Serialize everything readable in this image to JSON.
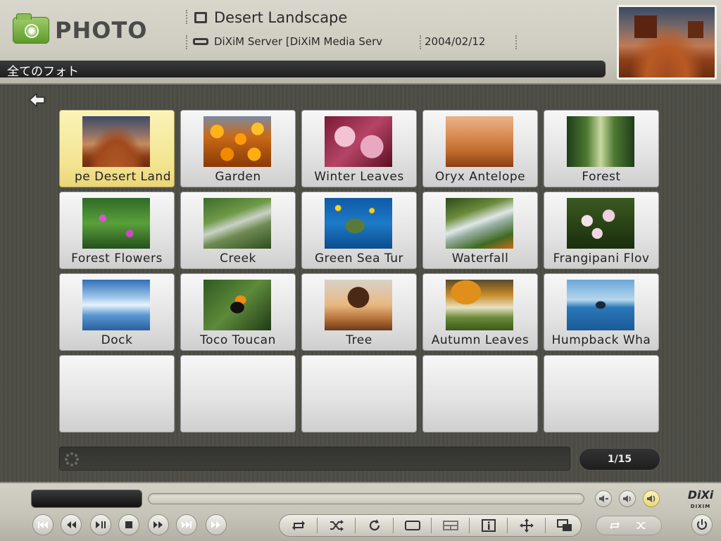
{
  "header": {
    "app_title": "PHOTO",
    "item_title": "Desert Landscape",
    "server_name": "DiXiM Server [DiXiM Media Serv",
    "date": "2004/02/12",
    "category": "全てのフォト"
  },
  "grid": {
    "tiles": [
      {
        "label": "pe  Desert Land",
        "thumb": "t-desert",
        "selected": true
      },
      {
        "label": "Garden",
        "thumb": "t-garden"
      },
      {
        "label": "Winter Leaves",
        "thumb": "t-winter"
      },
      {
        "label": "Oryx Antelope",
        "thumb": "t-oryx"
      },
      {
        "label": "Forest",
        "thumb": "t-forest"
      },
      {
        "label": "Forest Flowers",
        "thumb": "t-flowers"
      },
      {
        "label": "Creek",
        "thumb": "t-creek"
      },
      {
        "label": "Green Sea Tur",
        "thumb": "t-turtle"
      },
      {
        "label": "Waterfall",
        "thumb": "t-waterfall"
      },
      {
        "label": "Frangipani Flov",
        "thumb": "t-frangipani"
      },
      {
        "label": "Dock",
        "thumb": "t-dock"
      },
      {
        "label": "Toco Toucan",
        "thumb": "t-toucan"
      },
      {
        "label": "Tree",
        "thumb": "t-tree"
      },
      {
        "label": "Autumn Leaves",
        "thumb": "t-autumn"
      },
      {
        "label": "Humpback Wha",
        "thumb": "t-whale"
      },
      {
        "label": "",
        "thumb": ""
      },
      {
        "label": "",
        "thumb": ""
      },
      {
        "label": "",
        "thumb": ""
      },
      {
        "label": "",
        "thumb": ""
      },
      {
        "label": "",
        "thumb": ""
      }
    ]
  },
  "status": {
    "page_indicator": "1/15"
  },
  "footer": {
    "brand_main": "DiXi",
    "brand_sub": "DIXIM"
  },
  "colors": {
    "selected_tile": "#f3e490",
    "header_bg": "#cfccc1",
    "dark_bar": "#1f1f1f"
  }
}
